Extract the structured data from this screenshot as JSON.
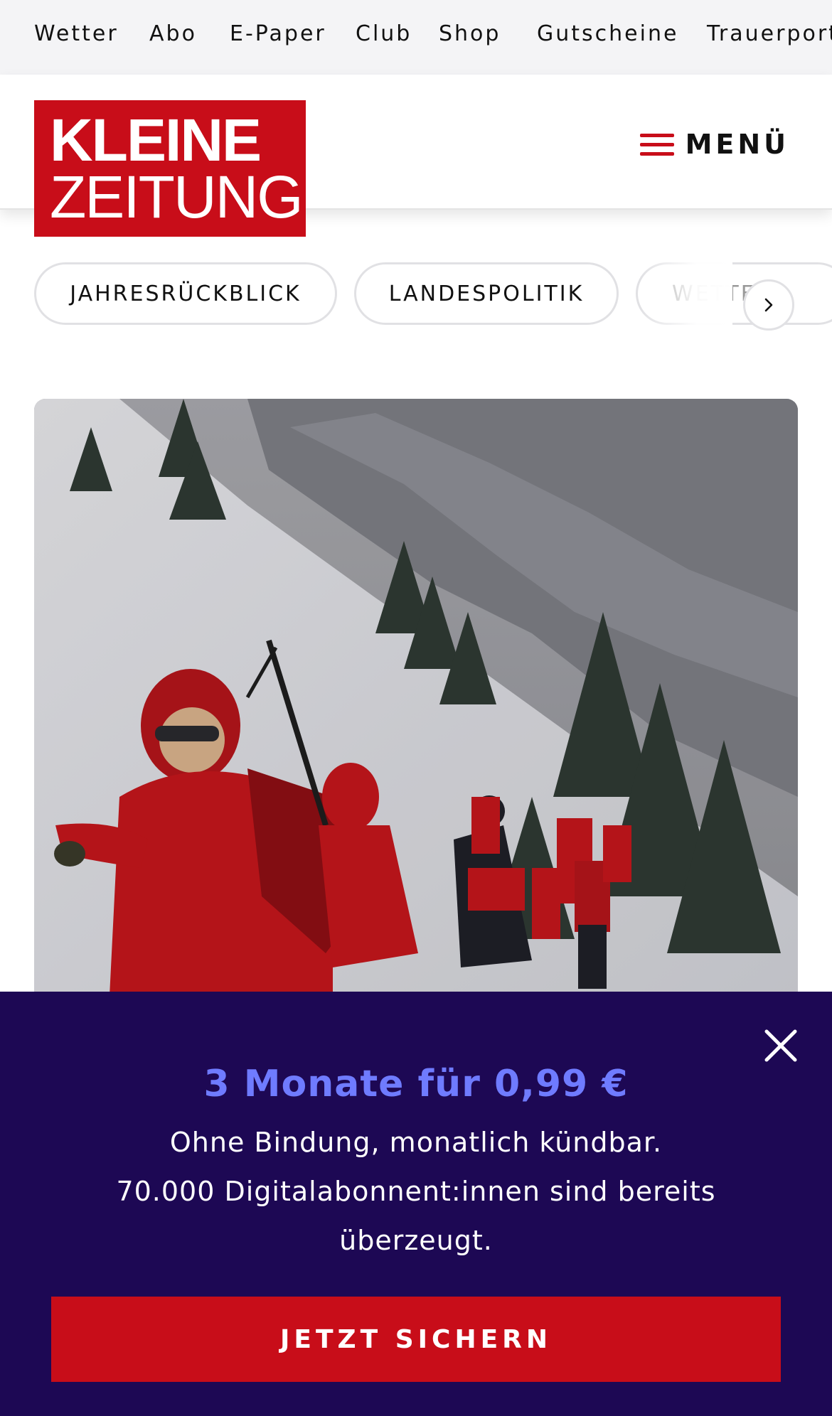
{
  "topnav": {
    "items": [
      "Wetter",
      "Abo",
      "E-Paper",
      "Club",
      "Shop",
      "Gutscheine",
      "Trauerportal"
    ]
  },
  "header": {
    "logo_line1": "KLEINE",
    "logo_line2": "ZEITUNG",
    "menu_label": "MENÜ"
  },
  "topics": {
    "chips": [
      "JAHRESRÜCKBLICK",
      "LANDESPOLITIK",
      "WETTER"
    ]
  },
  "hero": {
    "image": "mountain-rescue-team-in-snow"
  },
  "promo": {
    "headline": "3 Monate für 0,99 €",
    "line1": "Ohne Bindung, monatlich kündbar.",
    "line2": "70.000 Digitalabonnent:innen sind bereits überzeugt.",
    "cta_label": "JETZT SICHERN"
  },
  "colors": {
    "brand_red": "#c80d19",
    "promo_bg": "#1d0854",
    "promo_accent": "#6f7bff"
  }
}
